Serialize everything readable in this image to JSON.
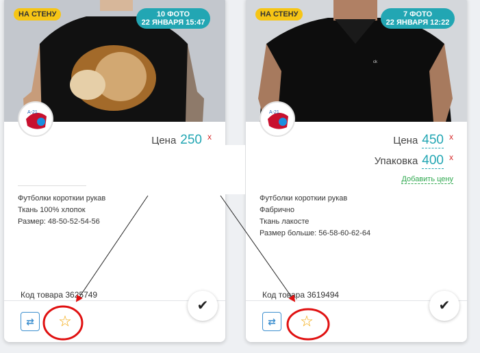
{
  "cards": [
    {
      "wall_badge": "НА СТЕНУ",
      "photo_count": "10 ФОТО",
      "photo_date": "22 ЯНВАРЯ 15:47",
      "watermark": "СТ921",
      "prices": [
        {
          "label": "Цена",
          "value": "250",
          "remove": "x"
        }
      ],
      "description": [
        "Футболки короткии рукав",
        "Ткань 100% хлопок",
        "Размер: 48-50-52-54-56"
      ],
      "code": "Код товара 3625749"
    },
    {
      "wall_badge": "НА СТЕНУ",
      "photo_count": "7 ФОТО",
      "photo_date": "22 ЯНВАРЯ 12:22",
      "watermark": "СТ921",
      "prices": [
        {
          "label": "Цена",
          "value": "450",
          "remove": "x"
        },
        {
          "label": "Упаковка",
          "value": "400",
          "remove": "x"
        }
      ],
      "add_price": "Добавить цену",
      "description": [
        "Футболки короткии рукав",
        "Фабрично",
        "Ткань лакосте",
        "Размер больше: 56-58-60-62-64"
      ],
      "code": "Код товара 3619494"
    }
  ],
  "icons": {
    "swap": "swap-arrows-icon",
    "star": "star-icon",
    "check": "check-icon"
  },
  "colors": {
    "accent": "#22a6b3",
    "badge_yellow": "#f6c515",
    "remove_red": "#d62b2b",
    "add_green": "#2fa84f",
    "star_orange": "#f2a400",
    "annotation_red": "#e01010"
  }
}
